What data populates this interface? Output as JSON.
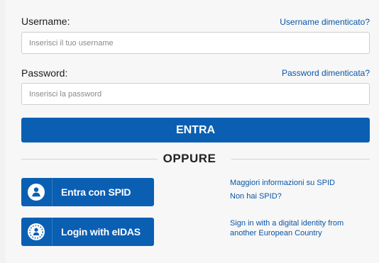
{
  "username": {
    "label": "Username:",
    "forgot_link": "Username dimenticato?",
    "placeholder": "Inserisci il tuo username"
  },
  "password": {
    "label": "Password:",
    "forgot_link": "Password dimenticata?",
    "placeholder": "Inserisci la password"
  },
  "submit_label": "ENTRA",
  "divider_text": "OPPURE",
  "spid": {
    "button_label": "Entra con SPID",
    "info_link": "Maggiori informazioni su SPID",
    "no_spid_link": "Non hai SPID?"
  },
  "eidas": {
    "button_label": "Login with eIDAS",
    "info_line1": "Sign in with a digital identity from",
    "info_line2": "another European Country"
  },
  "colors": {
    "primary": "#0a5fb3",
    "link": "#0a56a8",
    "background": "#f7f7f7"
  }
}
